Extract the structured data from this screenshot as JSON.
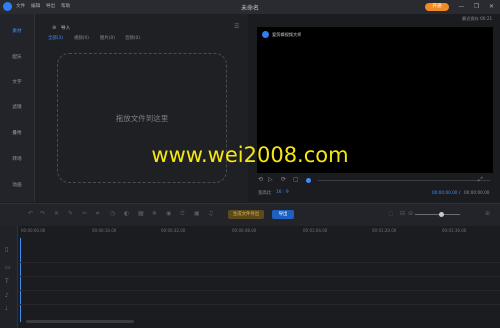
{
  "titlebar": {
    "menus": [
      "文件",
      "编辑",
      "导出",
      "帮助"
    ],
    "title": "未命名",
    "vip_label": "开通",
    "buttons": [
      "—",
      "❐",
      "✕"
    ]
  },
  "sidebar": {
    "items": [
      {
        "label": "素材",
        "active": true
      },
      {
        "label": "配乐",
        "active": false
      },
      {
        "label": "文字",
        "active": false
      },
      {
        "label": "滤镜",
        "active": false
      },
      {
        "label": "叠附",
        "active": false
      },
      {
        "label": "转场",
        "active": false
      },
      {
        "label": "动画",
        "active": false
      }
    ]
  },
  "media": {
    "import_label": "导入",
    "tabs": [
      "全部(3)",
      "视频(0)",
      "图片(0)",
      "音频(0)"
    ],
    "drop_hint": "拖放文件到这里"
  },
  "preview": {
    "recent_label": "最近保存 00:21",
    "video_title": "爱剪辑视频大师",
    "aspect_label": "宽高比",
    "aspect_value": "16 : 9",
    "time_current": "00:00:00.00",
    "time_total": "00:00:00.00"
  },
  "toolbar": {
    "export_label": "生成文件导出",
    "share_label": "导出"
  },
  "timeline": {
    "ticks": [
      "00:00:00.00",
      "00:00:16.00",
      "00:00:32.00",
      "00:00:48.00",
      "00:01:04.00",
      "00:01:20.00",
      "00:01:36.00"
    ]
  },
  "watermark": "www.wei2008.com"
}
